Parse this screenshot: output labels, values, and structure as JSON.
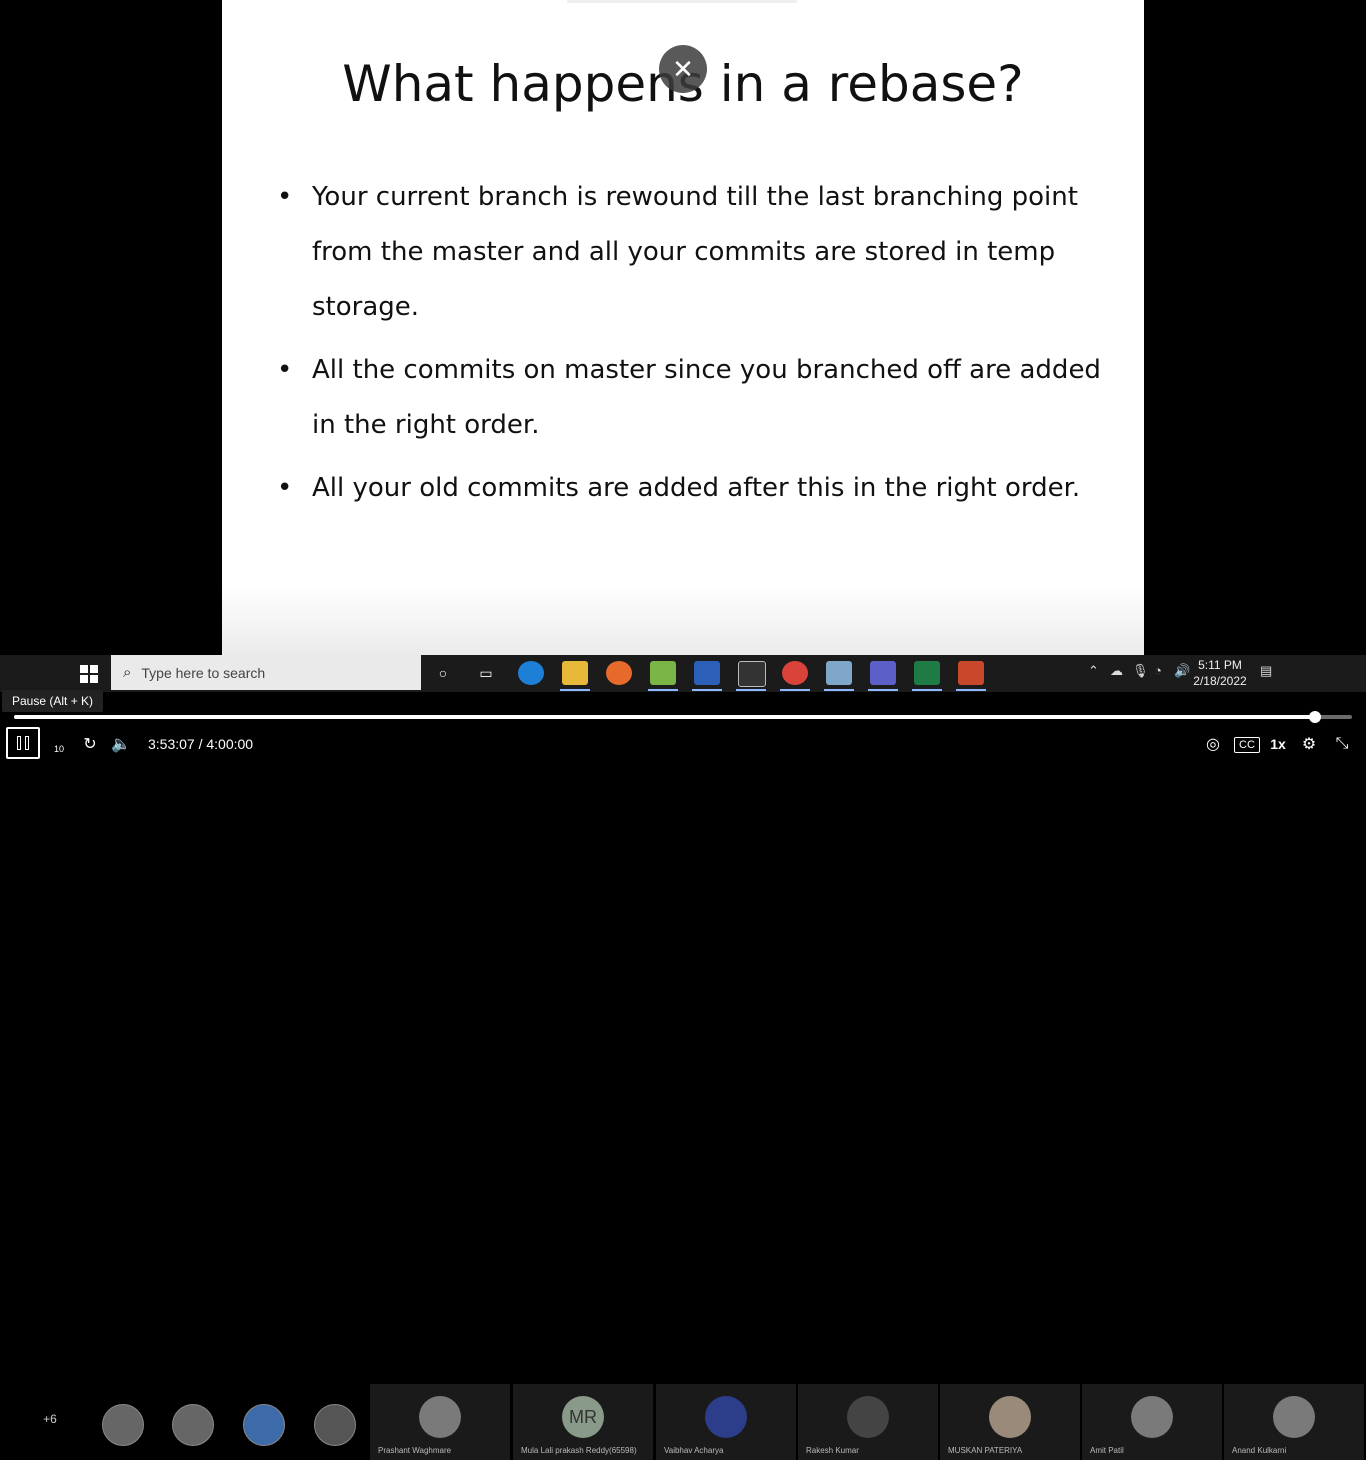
{
  "slide": {
    "title": "What happens in a rebase?",
    "bullets": [
      "Your current branch is rewound till the last branching point from the master and all your commits are stored in temp storage.",
      "All the commits on master since you branched off are added in the right order.",
      "All your old commits are added after this in the right order."
    ],
    "bullet_glyph": "•",
    "close_glyph": "✕"
  },
  "taskbar": {
    "search_placeholder": "Type here to search",
    "clock_time": "5:11 PM",
    "clock_date": "2/18/2022",
    "apps": [
      "cortana-icon",
      "task-view-icon",
      "edge-icon",
      "file-explorer-icon",
      "firefox-icon",
      "notepad-plus-icon",
      "word-icon",
      "terminal-icon",
      "chrome-icon",
      "snip-icon",
      "teams-icon",
      "excel-icon",
      "powerpoint-icon"
    ]
  },
  "player": {
    "tooltip": "Pause (Alt + K)",
    "time_display": "3:53:07 / 4:00:00",
    "progress_fraction": 0.972,
    "speed_label": "1x",
    "more_participants": "+6",
    "rewind_label": "10",
    "cc_label": "CC"
  },
  "participants": [
    {
      "name": "Prashant Waghmare",
      "initials": ""
    },
    {
      "name": "Mula Lali prakash Reddy(65598)",
      "initials": "MR"
    },
    {
      "name": "Vaibhav Acharya",
      "initials": ""
    },
    {
      "name": "Rakesh Kumar",
      "initials": ""
    },
    {
      "name": "MUSKAN PATERIYA",
      "initials": ""
    },
    {
      "name": "Amit Patil",
      "initials": ""
    },
    {
      "name": "Anand Kulkarni",
      "initials": ""
    }
  ]
}
